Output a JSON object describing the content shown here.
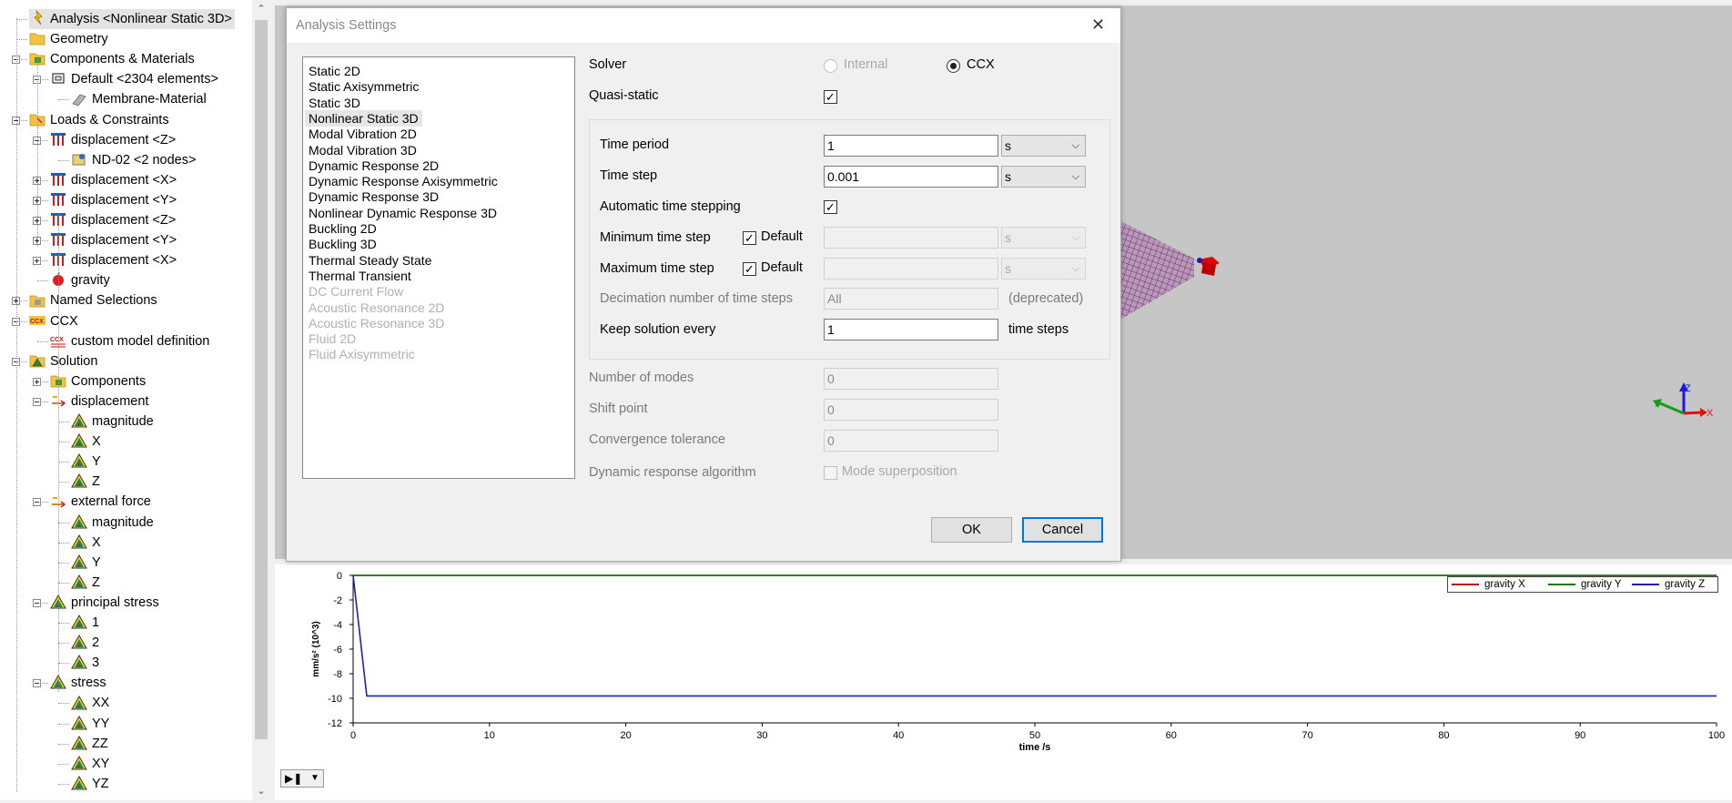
{
  "tree": {
    "items": [
      {
        "label": "Analysis <Nonlinear Static 3D>",
        "icon": "analysis-icon"
      },
      {
        "label": "Geometry",
        "icon": "folder-icon"
      },
      {
        "label": "Components & Materials",
        "icon": "components-icon"
      },
      {
        "label": "Default <2304 elements>",
        "icon": "component-icon"
      },
      {
        "label": "Membrane-Material",
        "icon": "material-icon"
      },
      {
        "label": "Loads & Constraints",
        "icon": "loads-folder-icon"
      },
      {
        "label": "displacement <Z>",
        "icon": "displacement-constraint-icon"
      },
      {
        "label": "ND-02 <2 nodes>",
        "icon": "node-set-icon"
      },
      {
        "label": "displacement <X>",
        "icon": "displacement-constraint-icon"
      },
      {
        "label": "displacement <Y>",
        "icon": "displacement-constraint-icon"
      },
      {
        "label": "displacement <Z>",
        "icon": "displacement-constraint-icon"
      },
      {
        "label": "displacement <Y>",
        "icon": "displacement-constraint-icon"
      },
      {
        "label": "displacement <X>",
        "icon": "displacement-constraint-icon"
      },
      {
        "label": "gravity",
        "icon": "gravity-icon"
      },
      {
        "label": "Named Selections",
        "icon": "named-selections-icon"
      },
      {
        "label": "CCX",
        "icon": "ccx-icon"
      },
      {
        "label": "custom model definition",
        "icon": "ccx-definition-icon"
      },
      {
        "label": "Solution",
        "icon": "solution-icon"
      },
      {
        "label": "Components",
        "icon": "components-icon"
      },
      {
        "label": "displacement",
        "icon": "vector-result-icon"
      },
      {
        "label": "magnitude",
        "icon": "result-icon"
      },
      {
        "label": "X",
        "icon": "result-icon"
      },
      {
        "label": "Y",
        "icon": "result-icon"
      },
      {
        "label": "Z",
        "icon": "result-icon"
      },
      {
        "label": "external force",
        "icon": "vector-result-icon"
      },
      {
        "label": "magnitude",
        "icon": "result-icon"
      },
      {
        "label": "X",
        "icon": "result-icon"
      },
      {
        "label": "Y",
        "icon": "result-icon"
      },
      {
        "label": "Z",
        "icon": "result-icon"
      },
      {
        "label": "principal stress",
        "icon": "result-icon"
      },
      {
        "label": "1",
        "icon": "result-icon"
      },
      {
        "label": "2",
        "icon": "result-icon"
      },
      {
        "label": "3",
        "icon": "result-icon"
      },
      {
        "label": "stress",
        "icon": "result-icon"
      },
      {
        "label": "XX",
        "icon": "result-icon"
      },
      {
        "label": "YY",
        "icon": "result-icon"
      },
      {
        "label": "ZZ",
        "icon": "result-icon"
      },
      {
        "label": "XY",
        "icon": "result-icon"
      },
      {
        "label": "YZ",
        "icon": "result-icon"
      }
    ]
  },
  "dialog": {
    "title": "Analysis Settings",
    "analysis_types": [
      {
        "label": "Static 2D",
        "state": "normal"
      },
      {
        "label": "Static Axisymmetric",
        "state": "normal"
      },
      {
        "label": "Static 3D",
        "state": "normal"
      },
      {
        "label": "Nonlinear Static 3D",
        "state": "selected"
      },
      {
        "label": "Modal Vibration 2D",
        "state": "normal"
      },
      {
        "label": "Modal Vibration 3D",
        "state": "normal"
      },
      {
        "label": "Dynamic Response 2D",
        "state": "normal"
      },
      {
        "label": "Dynamic Response Axisymmetric",
        "state": "normal"
      },
      {
        "label": "Dynamic Response 3D",
        "state": "normal"
      },
      {
        "label": "Nonlinear Dynamic Response 3D",
        "state": "normal"
      },
      {
        "label": "Buckling 2D",
        "state": "normal"
      },
      {
        "label": "Buckling 3D",
        "state": "normal"
      },
      {
        "label": "Thermal Steady State",
        "state": "normal"
      },
      {
        "label": "Thermal Transient",
        "state": "normal"
      },
      {
        "label": "DC Current Flow",
        "state": "disabled"
      },
      {
        "label": "Acoustic Resonance 2D",
        "state": "disabled"
      },
      {
        "label": "Acoustic Resonance 3D",
        "state": "disabled"
      },
      {
        "label": "Fluid 2D",
        "state": "disabled"
      },
      {
        "label": "Fluid Axisymmetric",
        "state": "disabled"
      }
    ],
    "solver_label": "Solver",
    "solver_internal": "Internal",
    "solver_ccx": "CCX",
    "quasi_static_label": "Quasi-static",
    "time_period_label": "Time period",
    "time_period_value": "1",
    "time_period_unit": "s",
    "time_step_label": "Time step",
    "time_step_value": "0.001",
    "time_step_unit": "s",
    "auto_step_label": "Automatic time stepping",
    "min_step_label": "Minimum time step",
    "min_step_default": "Default",
    "min_step_unit": "s",
    "max_step_label": "Maximum time step",
    "max_step_default": "Default",
    "max_step_unit": "s",
    "decimation_label": "Decimation number of time steps",
    "decimation_value": "All",
    "decimation_note": "(deprecated)",
    "keep_label": "Keep solution every",
    "keep_value": "1",
    "keep_unit": "time steps",
    "modes_label": "Number of modes",
    "modes_value": "0",
    "shift_label": "Shift point",
    "shift_value": "0",
    "tolerance_label": "Convergence tolerance",
    "tolerance_value": "0",
    "dyn_label": "Dynamic response algorithm",
    "dyn_option": "Mode superposition",
    "ok": "OK",
    "cancel": "Cancel"
  },
  "triad": {
    "x": "X",
    "y": "Y",
    "z": "Z"
  },
  "chart_data": {
    "type": "line",
    "xlabel": "time /s",
    "ylabel": "mm/s² (10^3)",
    "xlim": [
      0,
      100
    ],
    "ylim": [
      -12,
      0
    ],
    "xticks": [
      0,
      10,
      20,
      30,
      40,
      50,
      60,
      70,
      80,
      90,
      100
    ],
    "yticks": [
      0,
      -2,
      -4,
      -6,
      -8,
      -10,
      -12
    ],
    "legend": "top-right",
    "series": [
      {
        "name": "gravity X",
        "color": "#c0001f",
        "x": [
          0,
          100
        ],
        "y": [
          0,
          0
        ]
      },
      {
        "name": "gravity Y",
        "color": "#007d00",
        "x": [
          0,
          100
        ],
        "y": [
          0,
          0
        ]
      },
      {
        "name": "gravity Z",
        "color": "#1f1fb4",
        "x": [
          0,
          1,
          100
        ],
        "y": [
          0,
          -9.81,
          -9.81
        ]
      }
    ]
  }
}
